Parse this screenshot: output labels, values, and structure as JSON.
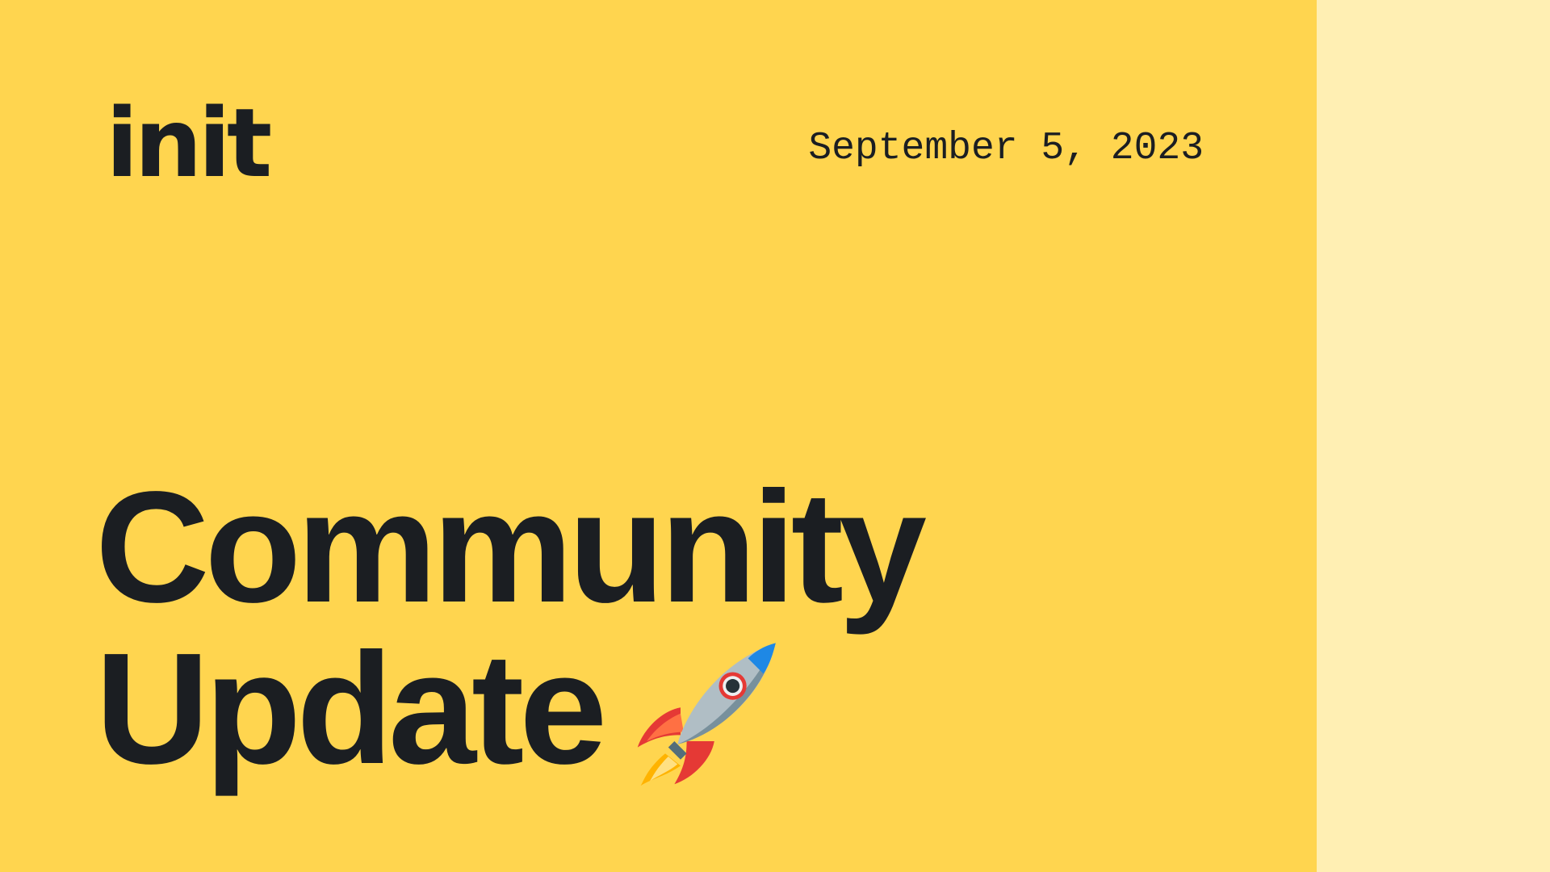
{
  "brand": {
    "logo_text": "init"
  },
  "date": "September 5, 2023",
  "headline": {
    "line1": "Community",
    "line2": "Update"
  },
  "icon": "rocket-icon",
  "colors": {
    "card_background": "#FFD54F",
    "side_panel_background": "#FFEFB3",
    "text": "#1B1E22"
  }
}
